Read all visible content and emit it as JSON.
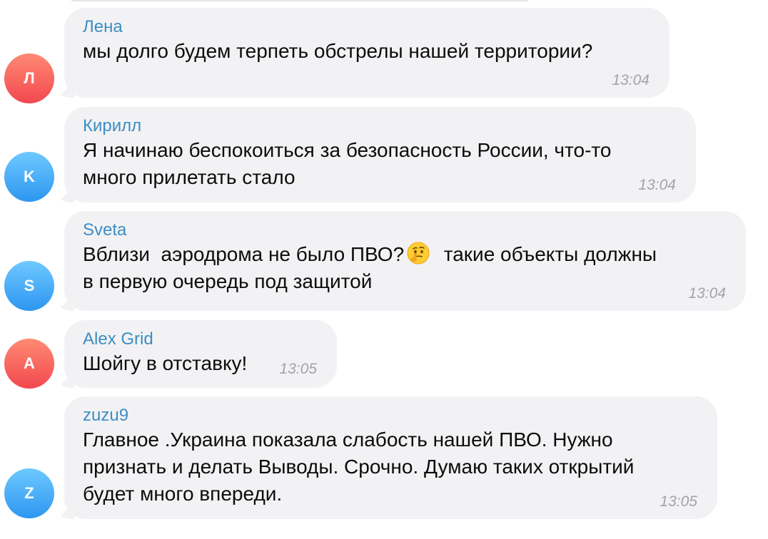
{
  "messages": [
    {
      "sender": "Лена",
      "avatar_letter": "Л",
      "avatar_color": "#f2484f",
      "text": "мы долго будем терпеть обстрелы нашей территории?",
      "time": "13:04"
    },
    {
      "sender": "Кирилл",
      "avatar_letter": "K",
      "avatar_color": "#2d96f0",
      "text": "Я начинаю беспокоиться за безопасность России, что-то\nмного прилетать стало",
      "time": "13:04"
    },
    {
      "sender": "Sveta",
      "avatar_letter": "S",
      "avatar_color": "#2d96f0",
      "text_before_emoji": "Вблизи  аэродрома не было ПВО?",
      "emoji": "thinking-face-icon",
      "text_after_emoji": "  такие объекты должны\nв первую очередь под защитой",
      "time": "13:04"
    },
    {
      "sender": "Alex Grid",
      "avatar_letter": "A",
      "avatar_color": "#f2484f",
      "text": "Шойгу в отставку!",
      "time": "13:05"
    },
    {
      "sender": "zuzu9",
      "avatar_letter": "Z",
      "avatar_color": "#2d96f0",
      "text": "Главное .Украина показала слабость нашей ПВО. Нужно\nпризнать и делать Выводы. Срочно. Думаю таких открытий\nбудет много впереди.",
      "time": "13:05"
    }
  ]
}
